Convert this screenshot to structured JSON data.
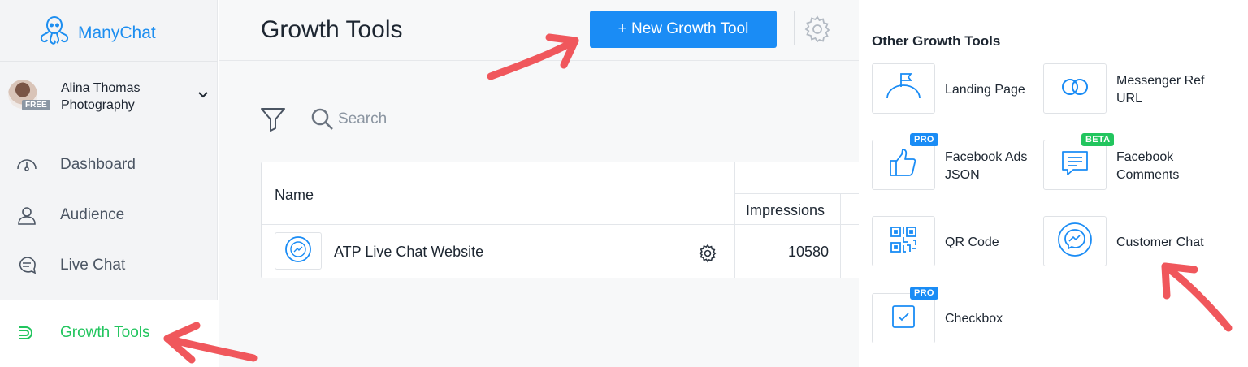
{
  "app": {
    "name": "ManyChat"
  },
  "account": {
    "name_line1": "Alina Thomas",
    "name_line2": "Photography",
    "plan_badge": "FREE"
  },
  "sidebar": {
    "items": [
      {
        "label": "Dashboard",
        "icon": "dashboard-icon"
      },
      {
        "label": "Audience",
        "icon": "person-icon"
      },
      {
        "label": "Live Chat",
        "icon": "chat-bubble-icon"
      },
      {
        "label": "Growth Tools",
        "icon": "growth-tools-icon",
        "active": true
      }
    ]
  },
  "main": {
    "title": "Growth Tools",
    "new_button": "+ New Growth Tool",
    "search_placeholder": "Search",
    "table": {
      "headers": {
        "name": "Name",
        "impressions": "Impressions"
      },
      "rows": [
        {
          "name": "ATP Live Chat Website",
          "impressions": "10580"
        }
      ]
    }
  },
  "panel": {
    "title": "Other Growth Tools",
    "tools": [
      {
        "label": "Landing Page",
        "icon": "flag-hill-icon",
        "tag": ""
      },
      {
        "label": "Messenger Ref URL",
        "icon": "link-rings-icon",
        "tag": ""
      },
      {
        "label": "Facebook Ads JSON",
        "icon": "thumbs-up-icon",
        "tag": "PRO"
      },
      {
        "label": "Facebook Comments",
        "icon": "comment-icon",
        "tag": "BETA"
      },
      {
        "label": "QR Code",
        "icon": "qr-code-icon",
        "tag": ""
      },
      {
        "label": "Customer Chat",
        "icon": "messenger-icon",
        "tag": ""
      },
      {
        "label": "Checkbox",
        "icon": "checkbox-icon",
        "tag": "PRO"
      }
    ]
  },
  "colors": {
    "accent": "#1a8cf5",
    "active_nav": "#22c55e",
    "annotation_arrow": "#f0575c"
  }
}
